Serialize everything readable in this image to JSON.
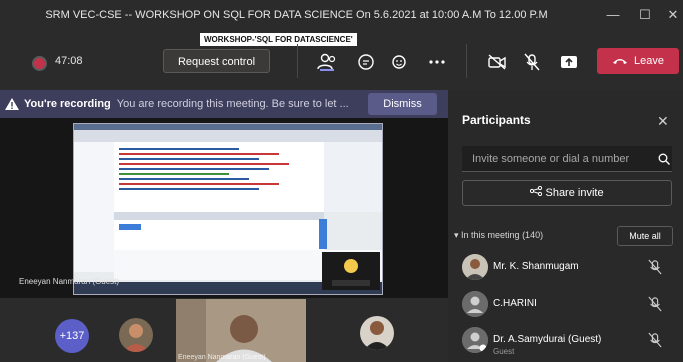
{
  "window": {
    "title": "SRM VEC-CSE -- WORKSHOP ON SQL FOR DATA SCIENCE On 5.6.2021 at 10:00 A.M To 12.00 P.M",
    "subtitle_tag": "WORKSHOP-'SQL  FOR DATASCIENCE'"
  },
  "toolbar": {
    "timer": "47:08",
    "request_control": "Request control",
    "leave": "Leave",
    "icons": [
      "people-icon",
      "chat-icon",
      "reactions-icon",
      "more-icon",
      "camera-off-icon",
      "mic-off-icon",
      "share-icon"
    ]
  },
  "recording_banner": {
    "bold": "You're recording",
    "message": "You are recording this meeting. Be sure to let ...",
    "dismiss": "Dismiss"
  },
  "stage": {
    "presenter": "Eneeyan Nanmaran (Guest)"
  },
  "bottom_strip": {
    "overflow_count": "+137",
    "video_caption": "Eneeyan Nanmaran (Guest)"
  },
  "panel": {
    "title": "Participants",
    "invite_placeholder": "Invite someone or dial a number",
    "share_invite": "Share invite",
    "in_meeting": "In this meeting (140)",
    "mute_all": "Mute all",
    "participants": [
      {
        "name": "Mr. K. Shanmugam",
        "sub": ""
      },
      {
        "name": "C.HARINI",
        "sub": ""
      },
      {
        "name": "Dr. A.Samydurai (Guest)",
        "sub": "Guest"
      }
    ]
  },
  "colors": {
    "leave": "#c4314b",
    "banner": "#3d3d5c",
    "accent": "#5b5fc7"
  }
}
